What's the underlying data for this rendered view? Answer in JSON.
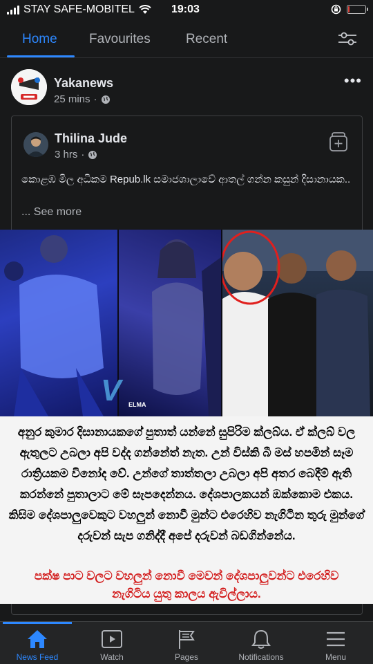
{
  "status_bar": {
    "carrier": "STAY SAFE-MOBITEL",
    "time": "19:03",
    "battery_level": 0.1
  },
  "tabs": [
    {
      "label": "Home",
      "active": true
    },
    {
      "label": "Favourites",
      "active": false
    },
    {
      "label": "Recent",
      "active": false
    }
  ],
  "post": {
    "author": "Yakanews",
    "time": "25 mins",
    "shared": {
      "author": "Thilina Jude",
      "time": "3 hrs",
      "text": "කොළඹ මිල අධිකම Repub.lk සමාජශාලාවේ ආතල් ගන්න කසුන් දිසානායක..",
      "see_more": "... See more"
    },
    "image": {
      "watermark": "V",
      "watermark_sub": "ELMA",
      "caption_main": "අනුර කුමාර දිසානායකගේ පුතාත් යන්නේ සුපිරිම ක්ලබ්ය. ඒ ක්ලබ් වල ඇතුලට උබලා අපි  වද්ද ගන්නේත් නැත. උන් විස්කි බී මස් හපමින් සෑම රාත්‍රියකම විනෝද වේ. උන්ගේ තාත්තලා උබලා අපි අතර බෙදීම් ඇති කරන්නේ පුතාලාට මේ සැපදෙන්නය. දේශපාලකයන් ඔක්කොම එකය. කිසිම දේශපාලුවෙකුට වහලුන් නොවී මුන්ට එරෙහිව නැගිටින තුරු මුන්ගේ දරුවන් සැප ගනිද්දී අපේ දරුවන් බඩගින්නේය.",
      "caption_red": "පක්ෂ පාට වලට වහලුන් නොවී මෙවන් දේශපාලුවන්ට එරෙහිව නැගිටිය යුතු කාලය ඇවිල්ලාය."
    }
  },
  "bottom_nav": [
    {
      "label": "News Feed",
      "icon": "home-icon",
      "active": true
    },
    {
      "label": "Watch",
      "icon": "watch-icon",
      "active": false
    },
    {
      "label": "Pages",
      "icon": "pages-flag-icon",
      "active": false
    },
    {
      "label": "Notifications",
      "icon": "bell-icon",
      "active": false
    },
    {
      "label": "Menu",
      "icon": "hamburger-icon",
      "active": false
    }
  ],
  "colors": {
    "accent": "#2d88ff",
    "background": "#18191a",
    "caption_red": "#d21a1a"
  }
}
